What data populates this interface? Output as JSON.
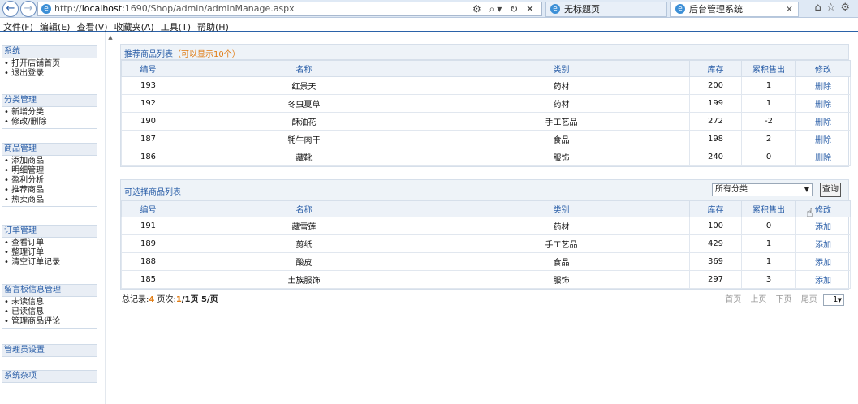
{
  "browser": {
    "url_prefix": "http://",
    "url_host": "localhost",
    "url_rest": ":1690/Shop/admin/adminManage.aspx",
    "tab1": "无标题页",
    "tab2": "后台管理系统",
    "menu": [
      "文件(F)",
      "编辑(E)",
      "查看(V)",
      "收藏夹(A)",
      "工具(T)",
      "帮助(H)"
    ]
  },
  "sidebar": [
    {
      "title": "系统",
      "items": [
        "打开店铺首页",
        "退出登录"
      ]
    },
    {
      "title": "分类管理",
      "items": [
        "新增分类",
        "修改/删除"
      ]
    },
    {
      "title": "商品管理",
      "items": [
        "添加商品",
        "明细管理",
        "盈利分析",
        "推荐商品",
        "热卖商品"
      ]
    },
    {
      "title": "订单管理",
      "items": [
        "查看订单",
        "整理订单",
        "清空订单记录"
      ]
    },
    {
      "title": "留言板信息管理",
      "items": [
        "未读信息",
        "已读信息",
        "管理商品评论"
      ]
    },
    {
      "title": "管理员设置",
      "items": []
    },
    {
      "title": "系统杂项",
      "items": []
    }
  ],
  "recommended": {
    "title": "推荐商品列表",
    "note": "（可以显示10个）",
    "headers": [
      "编号",
      "名称",
      "类别",
      "库存",
      "累积售出",
      "修改"
    ],
    "rows": [
      [
        "193",
        "红景天",
        "药材",
        "200",
        "1",
        "删除"
      ],
      [
        "192",
        "冬虫夏草",
        "药材",
        "199",
        "1",
        "删除"
      ],
      [
        "190",
        "酥油花",
        "手工艺品",
        "272",
        "-2",
        "删除"
      ],
      [
        "187",
        "牦牛肉干",
        "食品",
        "198",
        "2",
        "删除"
      ],
      [
        "186",
        "藏靴",
        "服饰",
        "240",
        "0",
        "删除"
      ]
    ]
  },
  "available": {
    "title": "可选择商品列表",
    "filter": "所有分类",
    "query_button": "查询",
    "headers": [
      "编号",
      "名称",
      "类别",
      "库存",
      "累积售出",
      "修改"
    ],
    "rows": [
      [
        "191",
        "藏雪莲",
        "药材",
        "100",
        "0",
        "添加"
      ],
      [
        "189",
        "剪纸",
        "手工艺品",
        "429",
        "1",
        "添加"
      ],
      [
        "188",
        "酸皮",
        "食品",
        "369",
        "1",
        "添加"
      ],
      [
        "185",
        "土族服饰",
        "服饰",
        "297",
        "3",
        "添加"
      ]
    ]
  },
  "footer": {
    "total_label": "总记录:",
    "total": "4",
    "page_label": " 页次:",
    "page_cur": "1",
    "page_sep": "/1页 ",
    "per_page": "5/页",
    "pager": [
      "首页",
      "上页",
      "下页",
      "尾页"
    ],
    "page_select": "1"
  }
}
